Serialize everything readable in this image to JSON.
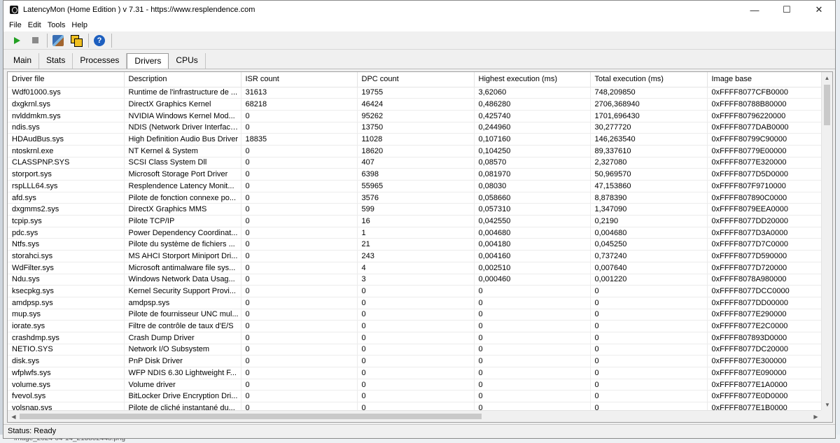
{
  "window": {
    "title": "LatencyMon  (Home Edition )  v 7.31 - https://www.resplendence.com",
    "minimize_glyph": "—",
    "maximize_glyph": "☐",
    "close_glyph": "✕"
  },
  "menu": {
    "items": [
      {
        "label": "File"
      },
      {
        "label": "Edit"
      },
      {
        "label": "Tools"
      },
      {
        "label": "Help"
      }
    ]
  },
  "toolbar": {
    "help_glyph": "?"
  },
  "tabs": [
    {
      "label": "Main"
    },
    {
      "label": "Stats"
    },
    {
      "label": "Processes"
    },
    {
      "label": "Drivers",
      "active": true
    },
    {
      "label": "CPUs"
    }
  ],
  "table": {
    "columns": [
      "Driver file",
      "Description",
      "ISR count",
      "DPC count",
      "Highest execution (ms)",
      "Total execution (ms)",
      "Image base"
    ],
    "rows": [
      [
        "Wdf01000.sys",
        "Runtime de l'infrastructure de ...",
        "31613",
        "19755",
        "3,62060",
        "748,209850",
        "0xFFFF8077CFB0000"
      ],
      [
        "dxgkrnl.sys",
        "DirectX Graphics Kernel",
        "68218",
        "46424",
        "0,486280",
        "2706,368940",
        "0xFFFF80788B80000"
      ],
      [
        "nvlddmkm.sys",
        "NVIDIA Windows Kernel Mod...",
        "0",
        "95262",
        "0,425740",
        "1701,696430",
        "0xFFFF80796220000"
      ],
      [
        "ndis.sys",
        "NDIS (Network Driver Interface...",
        "0",
        "13750",
        "0,244960",
        "30,277720",
        "0xFFFF8077DAB0000"
      ],
      [
        "HDAudBus.sys",
        "High Definition Audio Bus Driver",
        "18835",
        "11028",
        "0,107160",
        "146,263540",
        "0xFFFF80799C90000"
      ],
      [
        "ntoskrnl.exe",
        "NT Kernel & System",
        "0",
        "18620",
        "0,104250",
        "89,337610",
        "0xFFFF80779E00000"
      ],
      [
        "CLASSPNP.SYS",
        "SCSI Class System Dll",
        "0",
        "407",
        "0,08570",
        "2,327080",
        "0xFFFF8077E320000"
      ],
      [
        "storport.sys",
        "Microsoft Storage Port Driver",
        "0",
        "6398",
        "0,081970",
        "50,969570",
        "0xFFFF8077D5D0000"
      ],
      [
        "rspLLL64.sys",
        "Resplendence Latency Monit...",
        "0",
        "55965",
        "0,08030",
        "47,153860",
        "0xFFFF807F9710000"
      ],
      [
        "afd.sys",
        "Pilote de fonction connexe po...",
        "0",
        "3576",
        "0,058660",
        "8,878390",
        "0xFFFF807890C0000"
      ],
      [
        "dxgmms2.sys",
        "DirectX Graphics MMS",
        "0",
        "599",
        "0,057310",
        "1,347090",
        "0xFFFF8079EEA0000"
      ],
      [
        "tcpip.sys",
        "Pilote TCP/IP",
        "0",
        "16",
        "0,042550",
        "0,2190",
        "0xFFFF8077DD20000"
      ],
      [
        "pdc.sys",
        "Power Dependency Coordinat...",
        "0",
        "1",
        "0,004680",
        "0,004680",
        "0xFFFF8077D3A0000"
      ],
      [
        "Ntfs.sys",
        "Pilote du système de fichiers ...",
        "0",
        "21",
        "0,004180",
        "0,045250",
        "0xFFFF8077D7C0000"
      ],
      [
        "storahci.sys",
        "MS AHCI Storport Miniport Dri...",
        "0",
        "243",
        "0,004160",
        "0,737240",
        "0xFFFF8077D590000"
      ],
      [
        "WdFilter.sys",
        "Microsoft antimalware file sys...",
        "0",
        "4",
        "0,002510",
        "0,007640",
        "0xFFFF8077D720000"
      ],
      [
        "Ndu.sys",
        "Windows Network Data Usag...",
        "0",
        "3",
        "0,000460",
        "0,001220",
        "0xFFFF8078A980000"
      ],
      [
        "ksecpkg.sys",
        "Kernel Security Support Provi...",
        "0",
        "0",
        "0",
        "0",
        "0xFFFF8077DCC0000"
      ],
      [
        "amdpsp.sys",
        "amdpsp.sys",
        "0",
        "0",
        "0",
        "0",
        "0xFFFF8077DD00000"
      ],
      [
        "mup.sys",
        "Pilote de fournisseur UNC mul...",
        "0",
        "0",
        "0",
        "0",
        "0xFFFF8077E290000"
      ],
      [
        "iorate.sys",
        "Filtre de contrôle de taux d'E/S",
        "0",
        "0",
        "0",
        "0",
        "0xFFFF8077E2C0000"
      ],
      [
        "crashdmp.sys",
        "Crash Dump Driver",
        "0",
        "0",
        "0",
        "0",
        "0xFFFF807893D0000"
      ],
      [
        "NETIO.SYS",
        "Network I/O Subsystem",
        "0",
        "0",
        "0",
        "0",
        "0xFFFF8077DC20000"
      ],
      [
        "disk.sys",
        "PnP Disk Driver",
        "0",
        "0",
        "0",
        "0",
        "0xFFFF8077E300000"
      ],
      [
        "wfplwfs.sys",
        "WFP NDIS 6.30 Lightweight F...",
        "0",
        "0",
        "0",
        "0",
        "0xFFFF8077E090000"
      ],
      [
        "volume.sys",
        "Volume driver",
        "0",
        "0",
        "0",
        "0",
        "0xFFFF8077E1A0000"
      ],
      [
        "fvevol.sys",
        "BitLocker Drive Encryption Dri...",
        "0",
        "0",
        "0",
        "0",
        "0xFFFF8077E0D0000"
      ],
      [
        "volsnap.sys",
        "Pilote de cliché instantané du...",
        "0",
        "0",
        "0",
        "0",
        "0xFFFF8077E1B0000"
      ]
    ]
  },
  "status": {
    "text": "Status: Ready"
  },
  "background": {
    "bottom_fragment": "image_2024-04-14_213802448.png"
  }
}
